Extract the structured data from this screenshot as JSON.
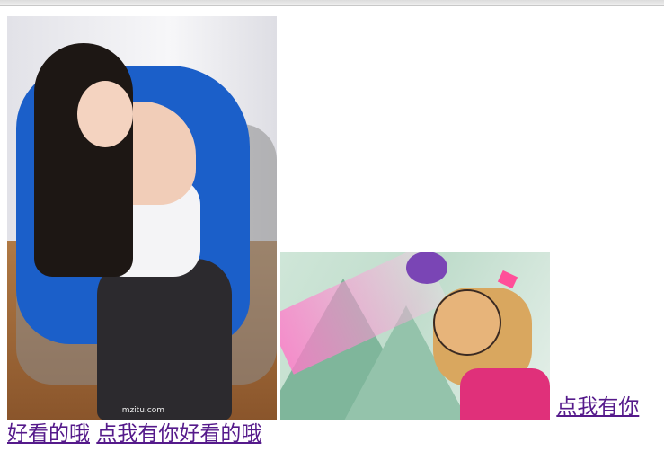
{
  "images": {
    "photo_1": {
      "watermark": "mzitu.com"
    }
  },
  "links": {
    "link_1": "点我有你好看的哦",
    "link_2": "点我有你好看的哦"
  }
}
